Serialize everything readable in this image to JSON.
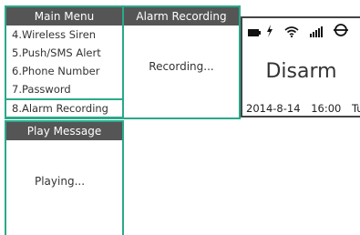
{
  "main_menu": {
    "title": "Main Menu",
    "items": [
      {
        "label": "4.Wireless Siren"
      },
      {
        "label": "5.Push/SMS Alert"
      },
      {
        "label": "6.Phone Number"
      },
      {
        "label": "7.Password"
      },
      {
        "label": "8.Alarm Recording",
        "selected": true
      }
    ]
  },
  "alarm_recording": {
    "title": "Alarm Recording",
    "status": "Recording..."
  },
  "play_message": {
    "title": "Play Message",
    "status": "Playing..."
  },
  "status_screen": {
    "icons": [
      "battery-icon",
      "power-flash-icon",
      "wifi-icon",
      "signal-bars-icon",
      "no-sim-icon"
    ],
    "mode": "Disarm",
    "date": "2014-8-14",
    "time": "16:00",
    "weekday": "Tue"
  },
  "colors": {
    "accent_border": "#2aa98a",
    "header_bg": "#555555",
    "header_text": "#ffffff"
  }
}
